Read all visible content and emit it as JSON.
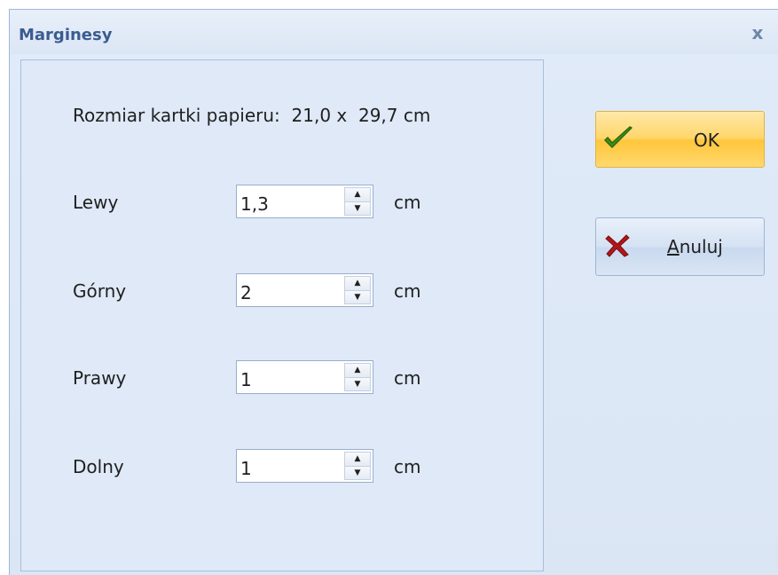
{
  "window": {
    "title": "Marginesy",
    "close_glyph": "x"
  },
  "paper_size": {
    "label": "Rozmiar kartki papieru:",
    "width": "21,0",
    "sep": "x",
    "height": "29,7",
    "unit": "cm"
  },
  "fields": [
    {
      "label": "Lewy",
      "value": "1,3",
      "unit": "cm"
    },
    {
      "label": "Górny",
      "value": "2",
      "unit": "cm"
    },
    {
      "label": "Prawy",
      "value": "1",
      "unit": "cm"
    },
    {
      "label": "Dolny",
      "value": "1",
      "unit": "cm"
    }
  ],
  "buttons": {
    "ok": {
      "label": "OK",
      "icon": "checkmark-icon",
      "color": "#4a9a1e"
    },
    "cancel": {
      "mnemonic": "A",
      "rest": "nuluj",
      "icon": "x-icon",
      "color": "#a01414"
    }
  }
}
